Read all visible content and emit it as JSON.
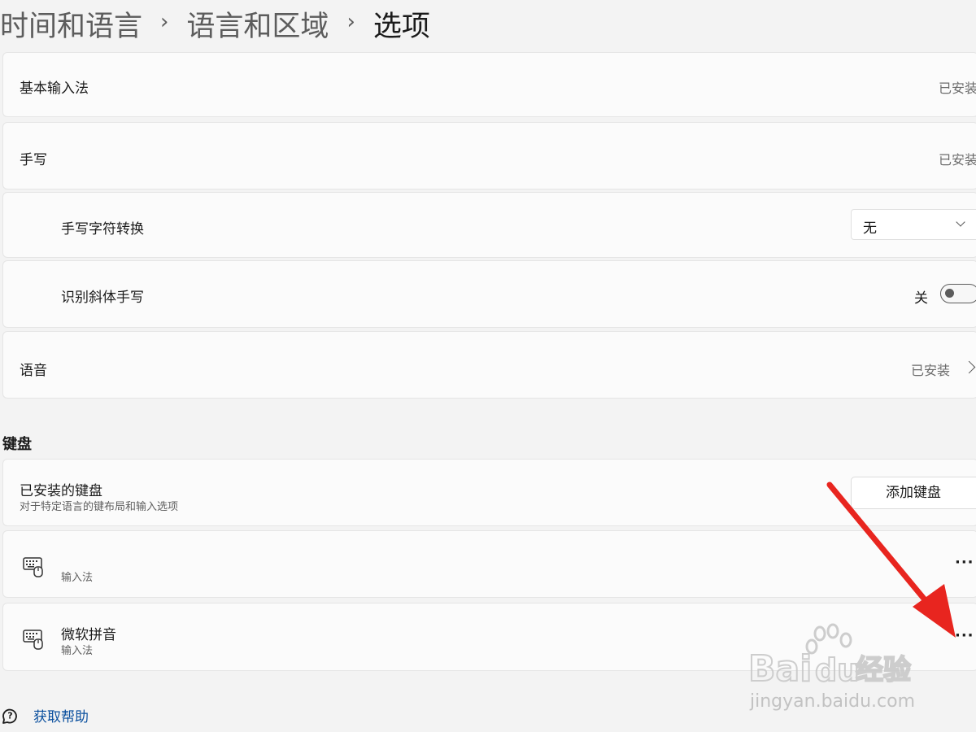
{
  "breadcrumb": {
    "item1": "时间和语言",
    "item2": "语言和区域",
    "current": "选项",
    "separator": "›"
  },
  "rows": {
    "basic_input": {
      "label": "基本输入法",
      "value": "已安装"
    },
    "handwriting": {
      "label": "手写",
      "value": "已安装"
    },
    "handwriting_conversion": {
      "label": "手写字符转换",
      "selected": "无"
    },
    "cursive": {
      "label": "识别斜体手写",
      "state_label": "关",
      "state": "off"
    },
    "speech": {
      "label": "语音",
      "value": "已安装"
    }
  },
  "keyboard": {
    "section_title": "键盘",
    "installed": {
      "label": "已安装的键盘",
      "description": "对于特定语言的键布局和输入选项",
      "add_button": "添加键盘"
    },
    "items": [
      {
        "name": "",
        "type": "输入法",
        "icon": "keyboard-icon",
        "more": "···"
      },
      {
        "name": "微软拼音",
        "type": "输入法",
        "icon": "keyboard-icon",
        "more": "···"
      }
    ]
  },
  "help": {
    "label": "获取帮助",
    "icon": "help-icon"
  },
  "annotation": {
    "arrow_color": "#e8251f"
  },
  "watermark": {
    "brand": "Bai du 经验",
    "url": "jingyan.baidu.com"
  },
  "colors": {
    "link": "#0a4f9e",
    "background": "#f3f3f3",
    "card": "#fbfbfb"
  }
}
